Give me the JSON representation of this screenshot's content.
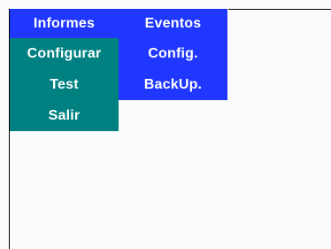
{
  "menu": {
    "left": [
      {
        "label": "Informes",
        "color": "#1f37ff"
      },
      {
        "label": "Configurar",
        "color": "#008080"
      },
      {
        "label": "Test",
        "color": "#008080"
      },
      {
        "label": "Salir",
        "color": "#008080"
      }
    ],
    "right": [
      {
        "label": "Eventos",
        "color": "#1f37ff"
      },
      {
        "label": "Config.",
        "color": "#1f37ff"
      },
      {
        "label": "BackUp.",
        "color": "#1f37ff"
      }
    ]
  },
  "colors": {
    "background": "#fbfbfb",
    "menu_blue": "#1f37ff",
    "menu_teal": "#008080",
    "text": "#ffffff",
    "border": "#000000"
  }
}
